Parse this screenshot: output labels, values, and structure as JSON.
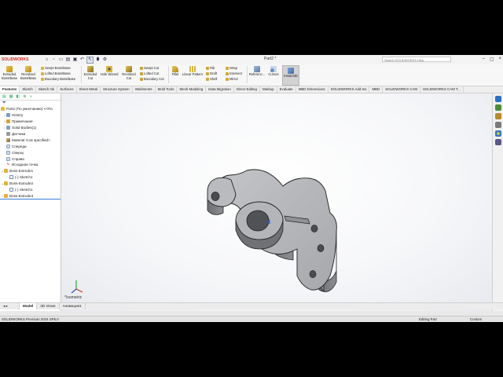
{
  "app": {
    "logo": "SOLIDWORKS",
    "document_title": "Part2 *",
    "search_placeholder": "Search SOLIDWORKS Help"
  },
  "quick_access_icons": [
    "home-icon",
    "new-icon",
    "open-icon",
    "save-icon",
    "print-icon",
    "undo-icon",
    "select-icon",
    "rebuild-icon",
    "options-icon"
  ],
  "ribbon": {
    "extruded_boss": "Extruded Boss/Base",
    "revolved_boss": "Revolved Boss/Base",
    "swept_boss": "Swept Boss/Base",
    "lofted_boss": "Lofted Boss/Base",
    "boundary_boss": "Boundary Boss/Base",
    "extruded_cut": "Extruded Cut",
    "hole_wizard": "Hole Wizard",
    "revolved_cut": "Revolved Cut",
    "swept_cut": "Swept Cut",
    "lofted_cut": "Lofted Cut",
    "boundary_cut": "Boundary Cut",
    "fillet": "Fillet",
    "linear_pattern": "Linear Pattern",
    "rib": "Rib",
    "draft": "Draft",
    "shell": "Shell",
    "wrap": "Wrap",
    "intersect": "Intersect",
    "mirror": "Mirror",
    "reference": "Referenc...",
    "curves": "Curves",
    "instant3d": "Instant3D"
  },
  "tabs": [
    "Features",
    "Sketch",
    "Sketch Ink",
    "Surfaces",
    "Sheet Metal",
    "Structure System",
    "Weldments",
    "Mold Tools",
    "Mesh Modeling",
    "Data Migration",
    "Direct Editing",
    "Markup",
    "Evaluate",
    "MBD Dimensions",
    "SOLIDWORKS Add-Ins",
    "MBD",
    "SOLIDWORKS CAM",
    "SOLIDWORKS CAM T..."
  ],
  "feature_tree": {
    "root": "Part2 (По умолчанию) <<По",
    "items": [
      {
        "label": "History"
      },
      {
        "label": "Примечания"
      },
      {
        "label": "Solid Bodies(1)"
      },
      {
        "label": "Датчики"
      },
      {
        "label": "Material <not specified>"
      },
      {
        "label": "Спереди"
      },
      {
        "label": "Сверху"
      },
      {
        "label": "Справа"
      },
      {
        "label": "Исходная точка"
      },
      {
        "label": "Boss-Extrude1"
      },
      {
        "label": "(-) Sketch1"
      },
      {
        "label": "Boss-Extrude2"
      },
      {
        "label": "(-) Sketch1"
      },
      {
        "label": "Boss-Extrude3"
      }
    ]
  },
  "viewport": {
    "view_label": "*Isometric"
  },
  "bottom_tabs": [
    "Model",
    "3D Views",
    "Анимация1"
  ],
  "status": {
    "product": "SOLIDWORKS Premium 2024 SP5.0",
    "mode": "Editing Part",
    "units": "Custom"
  },
  "colors": {
    "accent": "#d52b1e",
    "part": "#a9abae"
  }
}
